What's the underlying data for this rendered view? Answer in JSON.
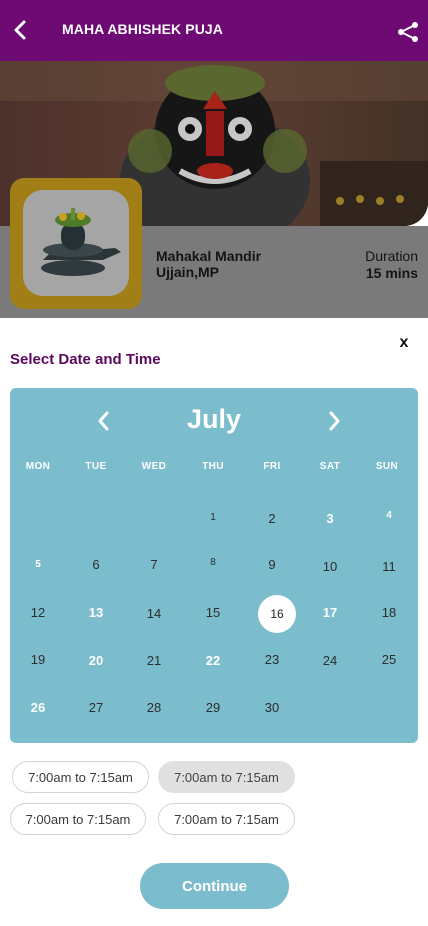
{
  "header": {
    "title": "MAHA ABHISHEK PUJA",
    "back_icon": "chevron-left-icon",
    "share_icon": "share-icon",
    "color": "#6d0a73"
  },
  "temple": {
    "name_line1": "Mahakal Mandir",
    "name_line2": "Ujjain,MP",
    "duration_label": "Duration",
    "duration_value": "15 mins"
  },
  "sheet": {
    "close_label": "x",
    "title": "Select Date and Time"
  },
  "calendar": {
    "month": "July",
    "weekdays": [
      "MON",
      "TUE",
      "WED",
      "THU",
      "FRI",
      "SAT",
      "SUN"
    ],
    "selected_day": "16",
    "accent": "#7bbccd",
    "weeks": [
      [
        "",
        "",
        "",
        "1",
        "2",
        "3",
        "4"
      ],
      [
        "5",
        "6",
        "7",
        "8",
        "9",
        "10",
        "11"
      ],
      [
        "12",
        "13",
        "14",
        "15",
        "16",
        "17",
        "18"
      ],
      [
        "19",
        "20",
        "21",
        "22",
        "23",
        "24",
        "25"
      ],
      [
        "26",
        "27",
        "28",
        "29",
        "30",
        "",
        ""
      ]
    ]
  },
  "time_slots": [
    "7:00am to 7:15am",
    "7:00am to 7:15am",
    "7:00am to 7:15am",
    "7:00am to 7:15am"
  ],
  "continue_label": "Continue"
}
